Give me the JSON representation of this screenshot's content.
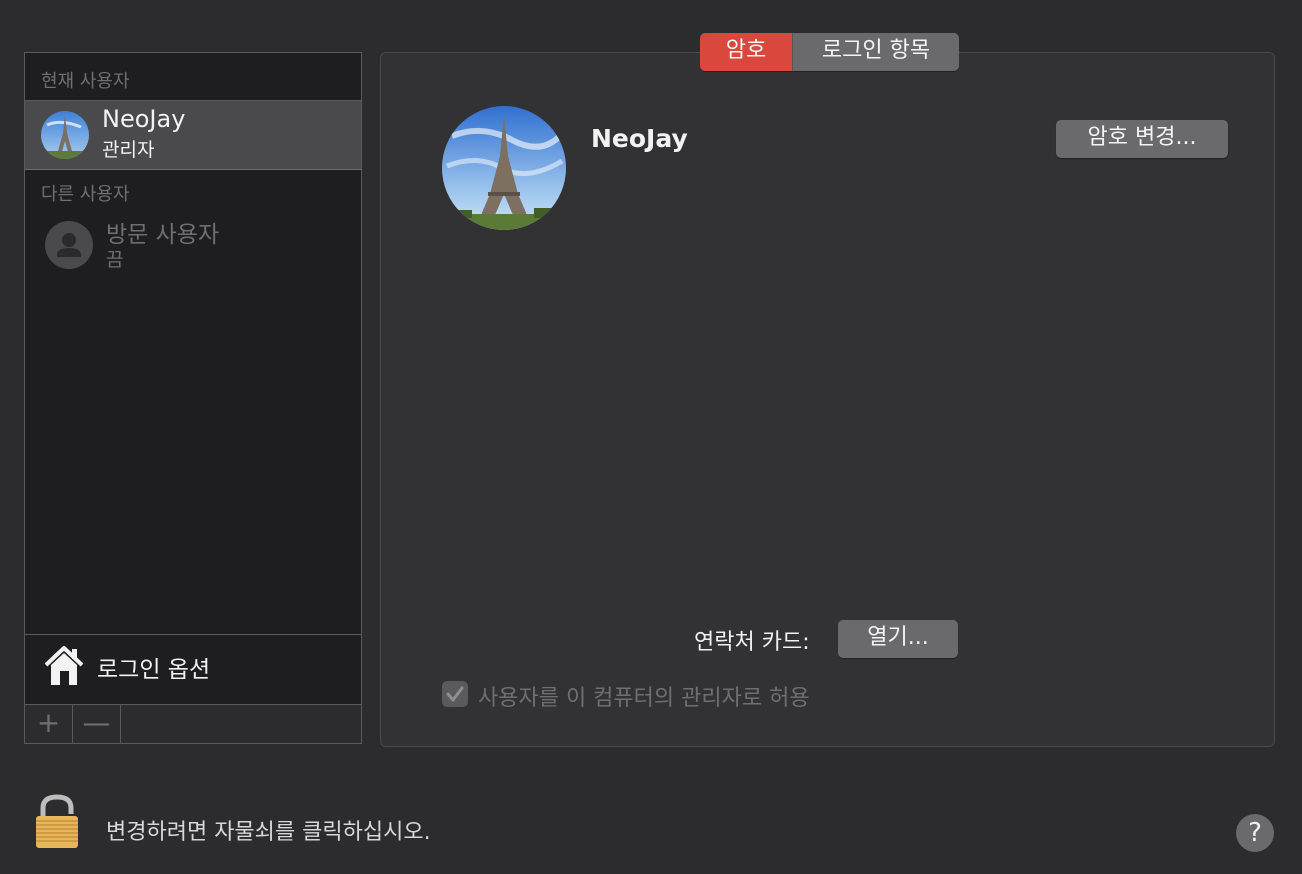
{
  "sidebar": {
    "current_users_header": "현재 사용자",
    "current_user": {
      "name": "NeoJay",
      "role": "관리자"
    },
    "other_users_header": "다른 사용자",
    "guest_user": {
      "name": "방문 사용자",
      "status": "끔"
    },
    "login_options_label": "로그인 옵션",
    "add_label": "+",
    "remove_label": "—"
  },
  "tabs": [
    {
      "label": "암호",
      "selected": true
    },
    {
      "label": "로그인 항목",
      "selected": false
    }
  ],
  "main": {
    "user_name": "NeoJay",
    "change_password_label": "암호 변경...",
    "contact_card_label": "연락처 카드:",
    "open_label": "열기...",
    "admin_checkbox_label": "사용자를 이 컴퓨터의 관리자로 허용",
    "admin_checked": true
  },
  "footer": {
    "lock_text": "변경하려면 자물쇠를 클릭하십시오.",
    "help_label": "?"
  },
  "colors": {
    "accent": "#d9473d",
    "background": "#2c2c2e",
    "sidebar_bg": "#1e1e20",
    "selected_row": "#4a4a4c"
  },
  "icons": [
    "eiffel-tower-avatar",
    "guest-person-icon",
    "house-icon",
    "lock-icon",
    "checkmark-icon",
    "help-icon"
  ]
}
